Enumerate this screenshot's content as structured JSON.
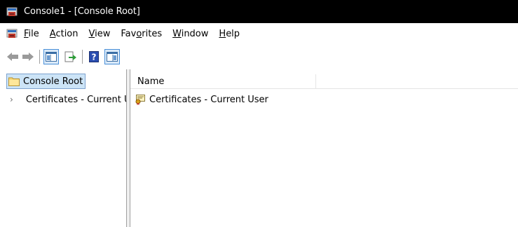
{
  "window": {
    "title": "Console1 - [Console Root]",
    "icon": "mmc-console-icon"
  },
  "menubar": {
    "icon": "mmc-console-icon",
    "items": [
      {
        "label_ul": "F",
        "label_rest": "ile"
      },
      {
        "label_ul": "A",
        "label_rest": "ction"
      },
      {
        "label_ul": "V",
        "label_rest": "iew"
      },
      {
        "label_pre": "Fav",
        "label_ul": "o",
        "label_rest": "rites"
      },
      {
        "label_ul": "W",
        "label_rest": "indow"
      },
      {
        "label_ul": "H",
        "label_rest": "elp"
      }
    ]
  },
  "toolbar": {
    "buttons": [
      "back-arrow-icon",
      "forward-arrow-icon",
      "show-hide-console-tree-icon",
      "export-list-icon",
      "help-icon",
      "show-hide-action-pane-icon"
    ]
  },
  "tree": {
    "root_label": "Console Root",
    "child_label": "Certificates - Current User"
  },
  "list": {
    "column_name": "Name",
    "rows": [
      {
        "label": "Certificates - Current User"
      }
    ]
  },
  "colors": {
    "titlebar": "#000000",
    "selection": "#cce4f7",
    "selection_border": "#7da2ce",
    "accent": "#4a90d9"
  }
}
